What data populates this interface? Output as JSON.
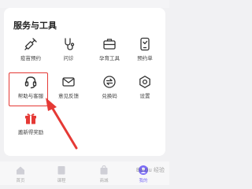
{
  "section": {
    "title": "服务与工具"
  },
  "tools": [
    {
      "label": "疫苗预约",
      "icon": "syringe-icon"
    },
    {
      "label": "问诊",
      "icon": "consult-icon"
    },
    {
      "label": "孕育工具",
      "icon": "briefcase-icon"
    },
    {
      "label": "预约单",
      "icon": "phone-icon"
    },
    {
      "label": "帮助与客服",
      "icon": "headset-icon"
    },
    {
      "label": "意见反馈",
      "icon": "mail-icon"
    },
    {
      "label": "兑换码",
      "icon": "exchange-icon"
    },
    {
      "label": "设置",
      "icon": "gear-icon"
    },
    {
      "label": "邀新得奖励",
      "icon": "gift-icon"
    }
  ],
  "tabbar": {
    "tabs": [
      {
        "label": "首页",
        "active": false
      },
      {
        "label": "课程",
        "active": false
      },
      {
        "label": "商城",
        "active": false
      },
      {
        "label": "我的",
        "active": true
      }
    ]
  },
  "watermark": {
    "text": "Baidu 经验"
  },
  "colors": {
    "highlight": "#e53935",
    "accent": "#7b6cf6",
    "gift": "#e53935"
  }
}
